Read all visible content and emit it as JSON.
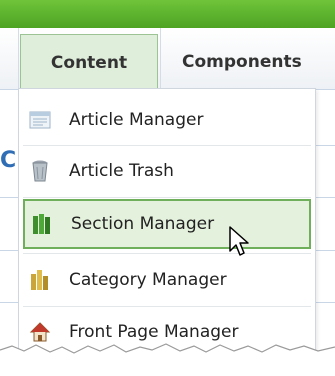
{
  "menubar": {
    "tabs": [
      {
        "label": "Content"
      },
      {
        "label": "Components"
      }
    ]
  },
  "background": {
    "partial_text": "C"
  },
  "content_menu": {
    "items": [
      {
        "label": "Article Manager",
        "icon": "article-manager-icon"
      },
      {
        "label": "Article Trash",
        "icon": "trash-icon"
      },
      {
        "label": "Section Manager",
        "icon": "section-manager-icon"
      },
      {
        "label": "Category Manager",
        "icon": "category-manager-icon"
      },
      {
        "label": "Front Page Manager",
        "icon": "home-icon"
      }
    ],
    "highlighted_item": "Section Manager"
  },
  "colors": {
    "topbar_green": "#5cb32e",
    "active_tab_bg": "#dfeedb",
    "hover_item_bg": "#e4f1dc",
    "hover_item_border": "#6fae5a",
    "partial_text_blue": "#2f6db5"
  }
}
